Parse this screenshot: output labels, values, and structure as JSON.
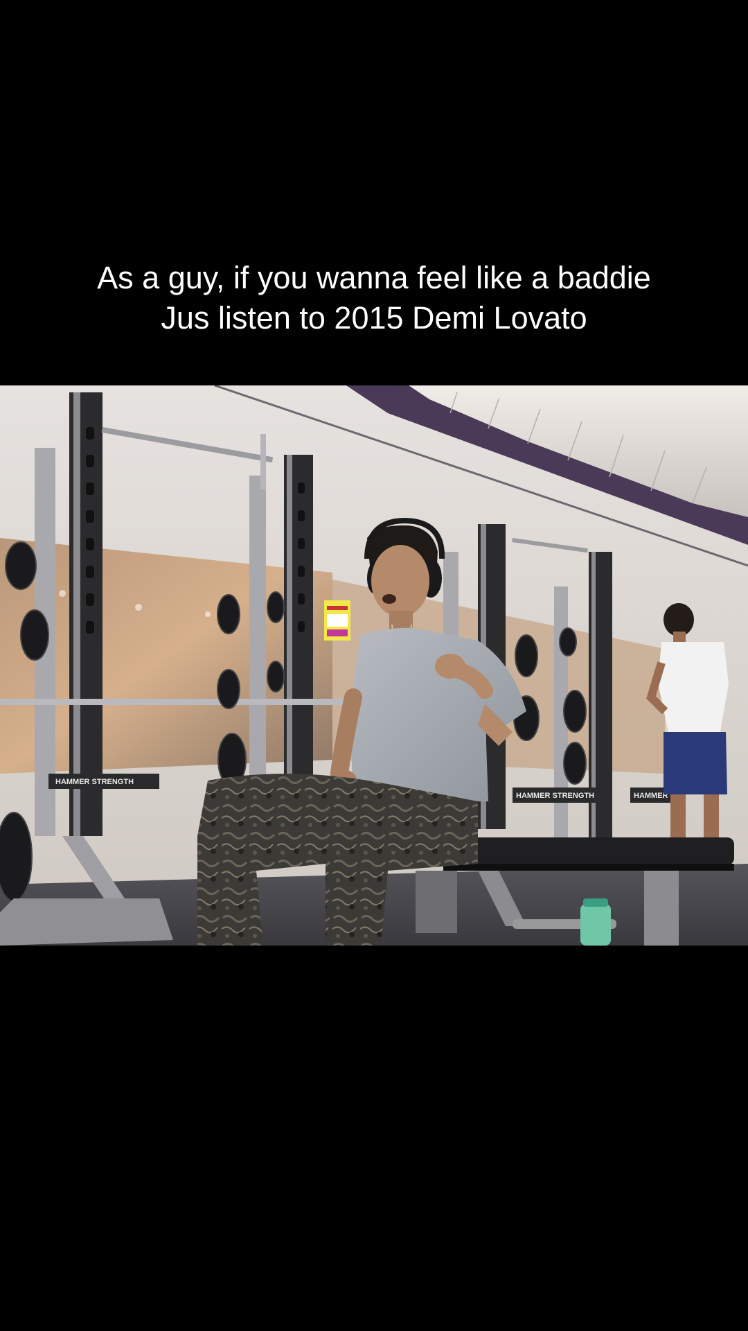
{
  "caption": {
    "line1": "As a guy, if you wanna feel like a baddie",
    "line2": "Jus listen to 2015 Demi Lovato"
  },
  "scene": {
    "equipment_brand_1": "HAMMER STRENGTH",
    "equipment_brand_2": "HAMMER STRENGTH",
    "equipment_brand_3": "HAMMER S"
  },
  "colors": {
    "background": "#000000",
    "caption_text": "#ffffff",
    "ceiling_purple": "#4a3a58",
    "wall": "#ddd8d4"
  }
}
